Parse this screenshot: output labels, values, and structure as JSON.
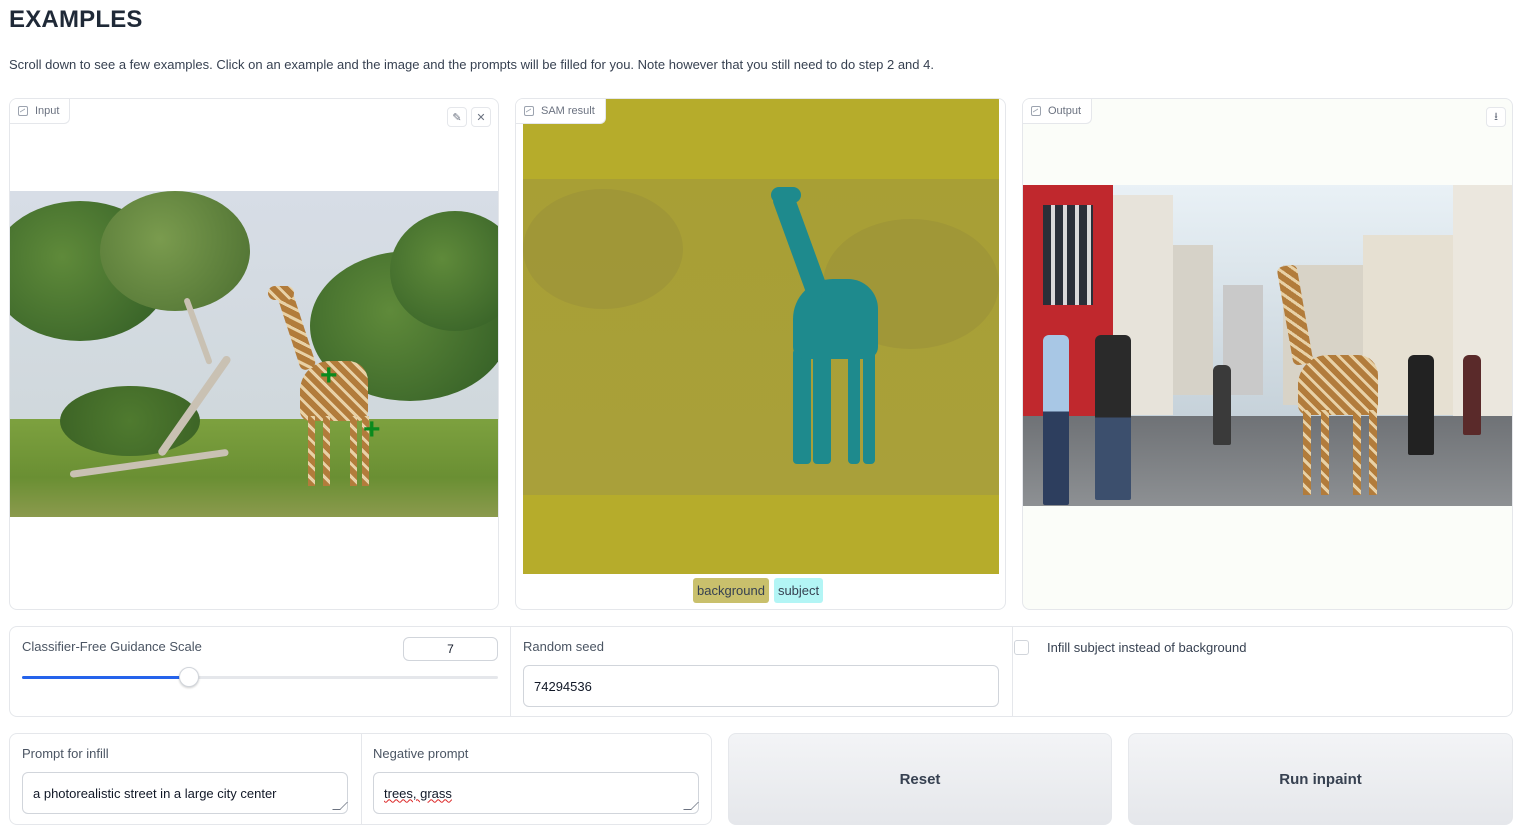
{
  "page": {
    "heading": "EXAMPLES",
    "description": "Scroll down to see a few examples. Click on an example and the image and the prompts will be filled for you. Note however that you still need to do step 2 and 4."
  },
  "panels": {
    "input": {
      "label": "Input",
      "icon": "image-icon",
      "tools": [
        "pencil-icon",
        "close-icon"
      ]
    },
    "sam": {
      "label": "SAM result",
      "icon": "image-icon"
    },
    "output": {
      "label": "Output",
      "icon": "image-icon",
      "tools": [
        "download-icon"
      ]
    }
  },
  "sam_legend": [
    {
      "label": "background",
      "color": "#c9c06c"
    },
    {
      "label": "subject",
      "color": "#b3f5f5"
    }
  ],
  "controls": {
    "guidance": {
      "label": "Classifier-Free Guidance Scale",
      "value": "7",
      "fraction": 0.35
    },
    "seed": {
      "label": "Random seed",
      "value": "74294536"
    },
    "infill_subject": {
      "label": "Infill subject instead of background",
      "checked": false
    }
  },
  "prompts": {
    "infill": {
      "label": "Prompt for infill",
      "value": "a photorealistic street in a large city center"
    },
    "negative": {
      "label": "Negative prompt",
      "value": "trees, grass"
    }
  },
  "buttons": {
    "reset": "Reset",
    "run": "Run inpaint"
  },
  "colors": {
    "accent": "#2563eb",
    "sam_background": "#b6ac2b",
    "sam_subject": "#1e8a8d"
  }
}
